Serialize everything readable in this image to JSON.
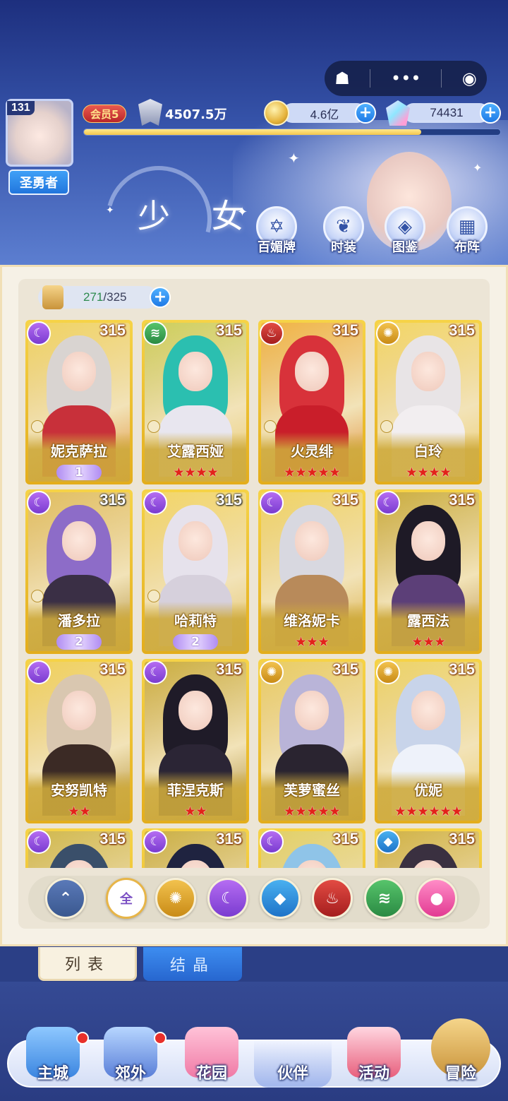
{
  "header": {
    "player_level": "131",
    "title_badge": "圣勇者",
    "vip": "会员5",
    "power": "4507.5万",
    "gold": "4.6亿",
    "gems": "74431",
    "xp_fraction": 0.81,
    "section_title": "少 女"
  },
  "miniapp_capsule": {
    "icons": [
      "ghost-icon",
      "more-icon",
      "target-icon"
    ]
  },
  "feature_buttons": [
    {
      "label": "百媚牌",
      "icon": "hexagram-icon"
    },
    {
      "label": "时装",
      "icon": "wardrobe-icon"
    },
    {
      "label": "图鉴",
      "icon": "book-icon"
    },
    {
      "label": "布阵",
      "icon": "grid-icon"
    }
  ],
  "bag": {
    "current": "271",
    "separator": "/",
    "max": "325"
  },
  "cards": [
    {
      "name": "妮克萨拉",
      "level": "315",
      "element": "moon",
      "stars": "",
      "wing": "1",
      "hair": "#d9d4d1",
      "outfit": "#c8303a"
    },
    {
      "name": "艾露西娅",
      "level": "315",
      "element": "wind",
      "stars": "★★★★",
      "wing": "",
      "hair": "#2bbfb0",
      "outfit": "#e8e6ef"
    },
    {
      "name": "火灵绯",
      "level": "315",
      "element": "fire",
      "stars": "★★★★★",
      "wing": "",
      "hair": "#d8323a",
      "outfit": "#c91e2a"
    },
    {
      "name": "白玲",
      "level": "315",
      "element": "sun",
      "stars": "★★★★",
      "wing": "",
      "hair": "#e8e4e6",
      "outfit": "#f2eef0"
    },
    {
      "name": "潘多拉",
      "level": "315",
      "element": "moon",
      "stars": "",
      "wing": "2",
      "hair": "#8d6cc8",
      "outfit": "#3a2f45"
    },
    {
      "name": "哈莉特",
      "level": "315",
      "element": "moon",
      "stars": "",
      "wing": "2",
      "hair": "#e6e2ec",
      "outfit": "#d6d0dc"
    },
    {
      "name": "维洛妮卡",
      "level": "315",
      "element": "moon",
      "stars": "★★★",
      "wing": "",
      "hair": "#d8d8e0",
      "outfit": "#b88a5a"
    },
    {
      "name": "露西法",
      "level": "315",
      "element": "moon",
      "stars": "★★★",
      "wing": "",
      "hair": "#1e1a26",
      "outfit": "#5c3f78"
    },
    {
      "name": "安努凯特",
      "level": "315",
      "element": "moon",
      "stars": "★★",
      "wing": "",
      "hair": "#d9c7b0",
      "outfit": "#3b2a25"
    },
    {
      "name": "菲涅克斯",
      "level": "315",
      "element": "moon",
      "stars": "★★",
      "wing": "",
      "hair": "#1f1b28",
      "outfit": "#2b2535"
    },
    {
      "name": "芙萝蜜丝",
      "level": "315",
      "element": "sun",
      "stars": "★★★★★",
      "wing": "",
      "hair": "#b9b4d8",
      "outfit": "#2a2430"
    },
    {
      "name": "优妮",
      "level": "315",
      "element": "sun",
      "stars": "★★★★★★",
      "wing": "",
      "hair": "#c8d4ea",
      "outfit": "#eef2fa"
    },
    {
      "name": "",
      "level": "315",
      "element": "moon",
      "stars": "",
      "wing": "",
      "hair": "#3a4f6a",
      "outfit": "#e6e6ee"
    },
    {
      "name": "",
      "level": "315",
      "element": "moon",
      "stars": "",
      "wing": "",
      "hair": "#1f2340",
      "outfit": "#3a3650"
    },
    {
      "name": "",
      "level": "315",
      "element": "moon",
      "stars": "",
      "wing": "",
      "hair": "#8fc4e8",
      "outfit": "#dfe8f3"
    },
    {
      "name": "",
      "level": "315",
      "element": "water",
      "stars": "",
      "wing": "",
      "hair": "#3a3040",
      "outfit": "#c24a3a"
    }
  ],
  "filters": [
    {
      "id": "up",
      "icon": "chevron-up-icon"
    },
    {
      "id": "all",
      "label": "全"
    },
    {
      "id": "sun",
      "icon": "sun-icon"
    },
    {
      "id": "moon",
      "icon": "moon-icon"
    },
    {
      "id": "water",
      "icon": "water-icon"
    },
    {
      "id": "fire",
      "icon": "fire-icon"
    },
    {
      "id": "wind",
      "icon": "wind-icon"
    },
    {
      "id": "star",
      "icon": "planet-icon"
    }
  ],
  "tabs": {
    "list": "列表",
    "crystal": "结晶"
  },
  "bottom_nav": [
    {
      "label": "主城",
      "badge": true
    },
    {
      "label": "郊外",
      "badge": true
    },
    {
      "label": "花园",
      "badge": false
    },
    {
      "label": "伙伴",
      "badge": false,
      "active": true
    },
    {
      "label": "活动",
      "badge": false
    },
    {
      "label": "冒险",
      "badge": false
    }
  ],
  "element_glyphs": {
    "moon": "☾",
    "wind": "≋",
    "fire": "♨",
    "sun": "✺",
    "water": "◆",
    "star": "●"
  },
  "colors": {
    "gold_card": "#f0c93a",
    "accent_blue": "#2a7be6",
    "badge_red": "#e8302b"
  }
}
